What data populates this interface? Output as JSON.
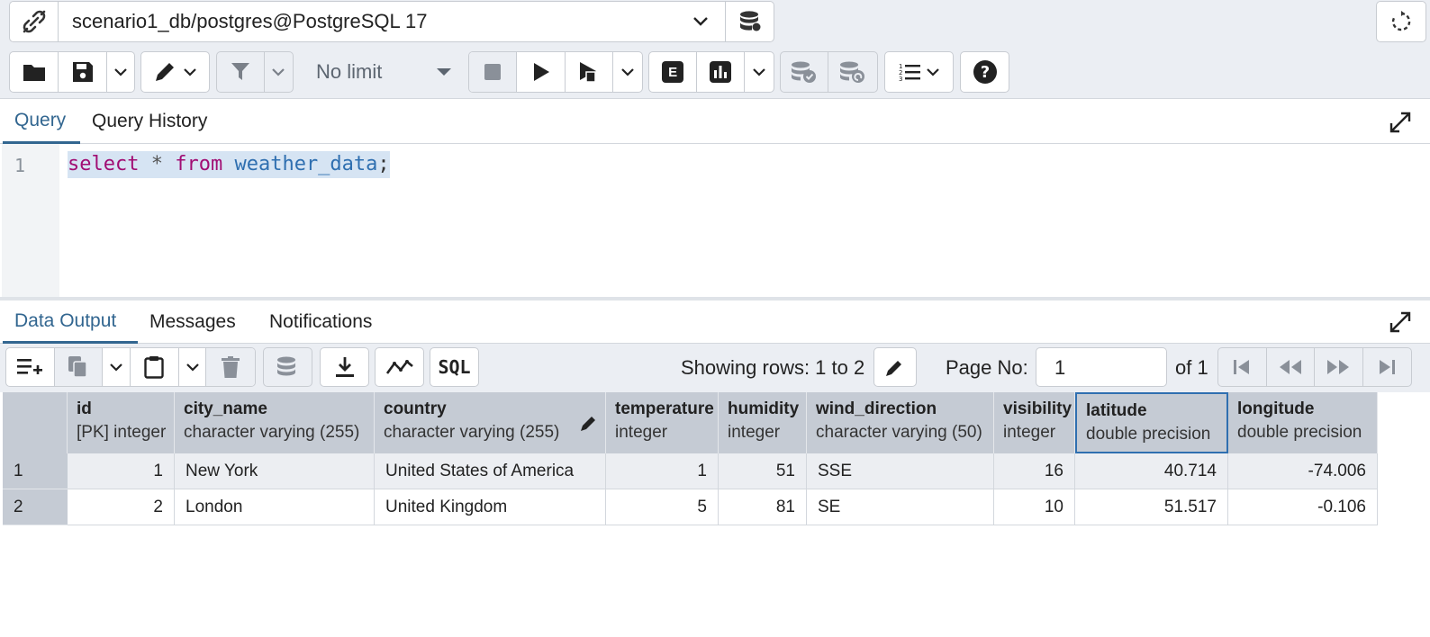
{
  "connection": {
    "label": "scenario1_db/postgres@PostgreSQL 17"
  },
  "toolbar": {
    "limit_label": "No limit",
    "explain_label": "E",
    "sql_label": "SQL"
  },
  "query_tabs": [
    {
      "label": "Query",
      "active": true
    },
    {
      "label": "Query History",
      "active": false
    }
  ],
  "editor": {
    "line_number": "1",
    "tokens": {
      "select": "select",
      "star": "*",
      "from": "from",
      "table": "weather_data",
      "semicolon": ";"
    }
  },
  "output_tabs": [
    {
      "label": "Data Output",
      "active": true
    },
    {
      "label": "Messages",
      "active": false
    },
    {
      "label": "Notifications",
      "active": false
    }
  ],
  "output_toolbar": {
    "rows_info": "Showing rows: 1 to 2",
    "page_label": "Page No:",
    "page_value": "1",
    "page_of": "of 1",
    "sql_label": "SQL"
  },
  "grid": {
    "columns": [
      {
        "name": "id",
        "type": "[PK] integer"
      },
      {
        "name": "city_name",
        "type": "character varying (255)"
      },
      {
        "name": "country",
        "type": "character varying (255)"
      },
      {
        "name": "temperature",
        "type": "integer"
      },
      {
        "name": "humidity",
        "type": "integer"
      },
      {
        "name": "wind_direction",
        "type": "character varying (50)"
      },
      {
        "name": "visibility",
        "type": "integer"
      },
      {
        "name": "latitude",
        "type": "double precision"
      },
      {
        "name": "longitude",
        "type": "double precision"
      }
    ],
    "rows": [
      {
        "n": "1",
        "cells": [
          "1",
          "New York",
          "United States of America",
          "1",
          "51",
          "SSE",
          "16",
          "40.714",
          "-74.006"
        ]
      },
      {
        "n": "2",
        "cells": [
          "2",
          "London",
          "United Kingdom",
          "5",
          "81",
          "SE",
          "10",
          "51.517",
          "-0.106"
        ]
      }
    ]
  },
  "colors": {
    "accent": "#326690",
    "keyword": "#a10d73",
    "identifier": "#2f6fb0",
    "header_bg": "#c5cbd4",
    "selection": "#d6e4f3"
  }
}
